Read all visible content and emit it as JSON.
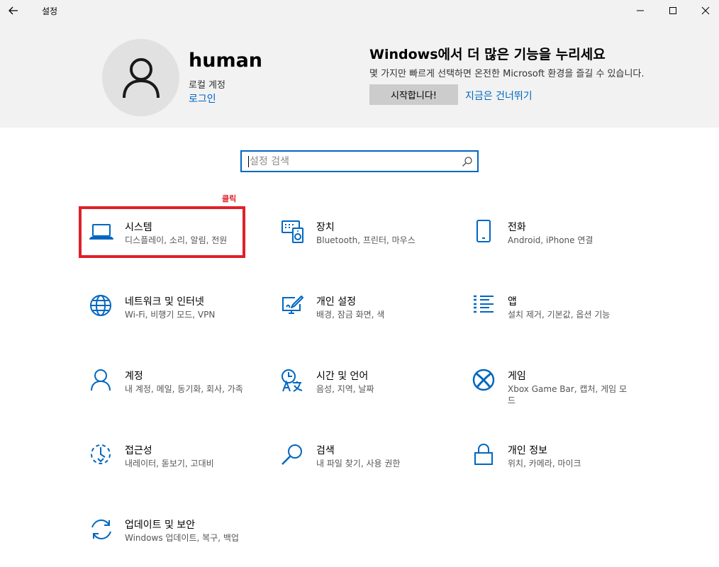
{
  "window": {
    "title": "설정"
  },
  "profile": {
    "name": "human",
    "account_type": "로컬 계정",
    "signin_label": "로그인"
  },
  "promo": {
    "title": "Windows에서 더 많은 기능을 누리세요",
    "description": "몇 가지만 빠르게 선택하면 온전한 Microsoft 환경을 즐길 수 있습니다.",
    "start_label": "시작합니다!",
    "skip_label": "지금은 건너뛰기"
  },
  "search": {
    "placeholder": "설정 검색",
    "value": ""
  },
  "annotation": {
    "click_label": "클릭",
    "color": "#e0202a"
  },
  "accent_color": "#0067c0",
  "categories": [
    {
      "title": "시스템",
      "desc": "디스플레이, 소리, 알림, 전원",
      "icon": "laptop-icon"
    },
    {
      "title": "장치",
      "desc": "Bluetooth, 프린터, 마우스",
      "icon": "devices-icon"
    },
    {
      "title": "전화",
      "desc": "Android, iPhone 연결",
      "icon": "phone-icon"
    },
    {
      "title": "네트워크 및 인터넷",
      "desc": "Wi-Fi, 비행기 모드, VPN",
      "icon": "globe-icon"
    },
    {
      "title": "개인 설정",
      "desc": "배경, 잠금 화면, 색",
      "icon": "personalization-icon"
    },
    {
      "title": "앱",
      "desc": "설치 제거, 기본값, 옵션 기능",
      "icon": "apps-list-icon"
    },
    {
      "title": "계정",
      "desc": "내 계정, 메일, 동기화, 회사, 가족",
      "icon": "person-icon"
    },
    {
      "title": "시간 및 언어",
      "desc": "음성, 지역, 날짜",
      "icon": "time-language-icon"
    },
    {
      "title": "게임",
      "desc": "Xbox Game Bar, 캡처, 게임 모드",
      "icon": "xbox-icon"
    },
    {
      "title": "접근성",
      "desc": "내레이터, 돋보기, 고대비",
      "icon": "accessibility-icon"
    },
    {
      "title": "검색",
      "desc": "내 파일 찾기, 사용 권한",
      "icon": "search-icon"
    },
    {
      "title": "개인 정보",
      "desc": "위치, 카메라, 마이크",
      "icon": "lock-icon"
    },
    {
      "title": "업데이트 및 보안",
      "desc": "Windows 업데이트, 복구, 백업",
      "icon": "update-icon"
    }
  ]
}
